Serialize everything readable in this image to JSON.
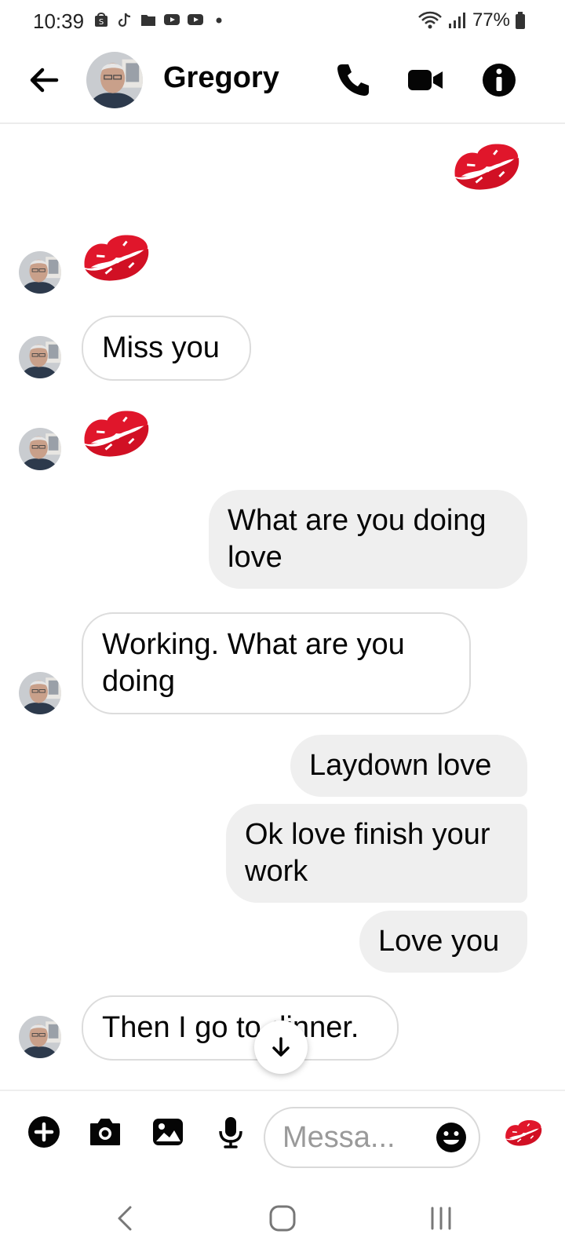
{
  "status": {
    "time": "10:39",
    "battery": "77%",
    "icons": [
      "shopping-bag-icon",
      "tiktok-icon",
      "folder-icon",
      "youtube-icon",
      "youtube-icon",
      "dot-icon"
    ]
  },
  "header": {
    "contact_name": "Gregory",
    "icons": [
      "back-arrow-icon",
      "phone-icon",
      "video-camera-icon",
      "info-icon"
    ]
  },
  "messages": [
    {
      "side": "out",
      "type": "emoji",
      "icon": "kiss-mark-icon"
    },
    {
      "side": "in",
      "type": "emoji",
      "icon": "kiss-mark-icon"
    },
    {
      "side": "in",
      "type": "text",
      "text": "Miss you"
    },
    {
      "side": "in",
      "type": "emoji",
      "icon": "kiss-mark-icon"
    },
    {
      "side": "out",
      "type": "text",
      "text": "What are you doing love"
    },
    {
      "side": "in",
      "type": "text",
      "text": "Working. What are you doing"
    },
    {
      "side": "out",
      "type": "text",
      "text": "Laydown love"
    },
    {
      "side": "out",
      "type": "text",
      "text": "Ok love finish your work"
    },
    {
      "side": "out",
      "type": "text",
      "text": "Love you"
    },
    {
      "side": "in",
      "type": "text",
      "text": "Then I go to dinner."
    }
  ],
  "composer": {
    "placeholder": "Messa...",
    "icons": [
      "plus-icon",
      "camera-icon",
      "image-icon",
      "microphone-icon",
      "emoji-icon",
      "kiss-mark-icon"
    ]
  },
  "colors": {
    "kiss_red": "#e0162b",
    "incoming_border": "#dcdcdc",
    "outgoing_bubble": "#efefef"
  }
}
